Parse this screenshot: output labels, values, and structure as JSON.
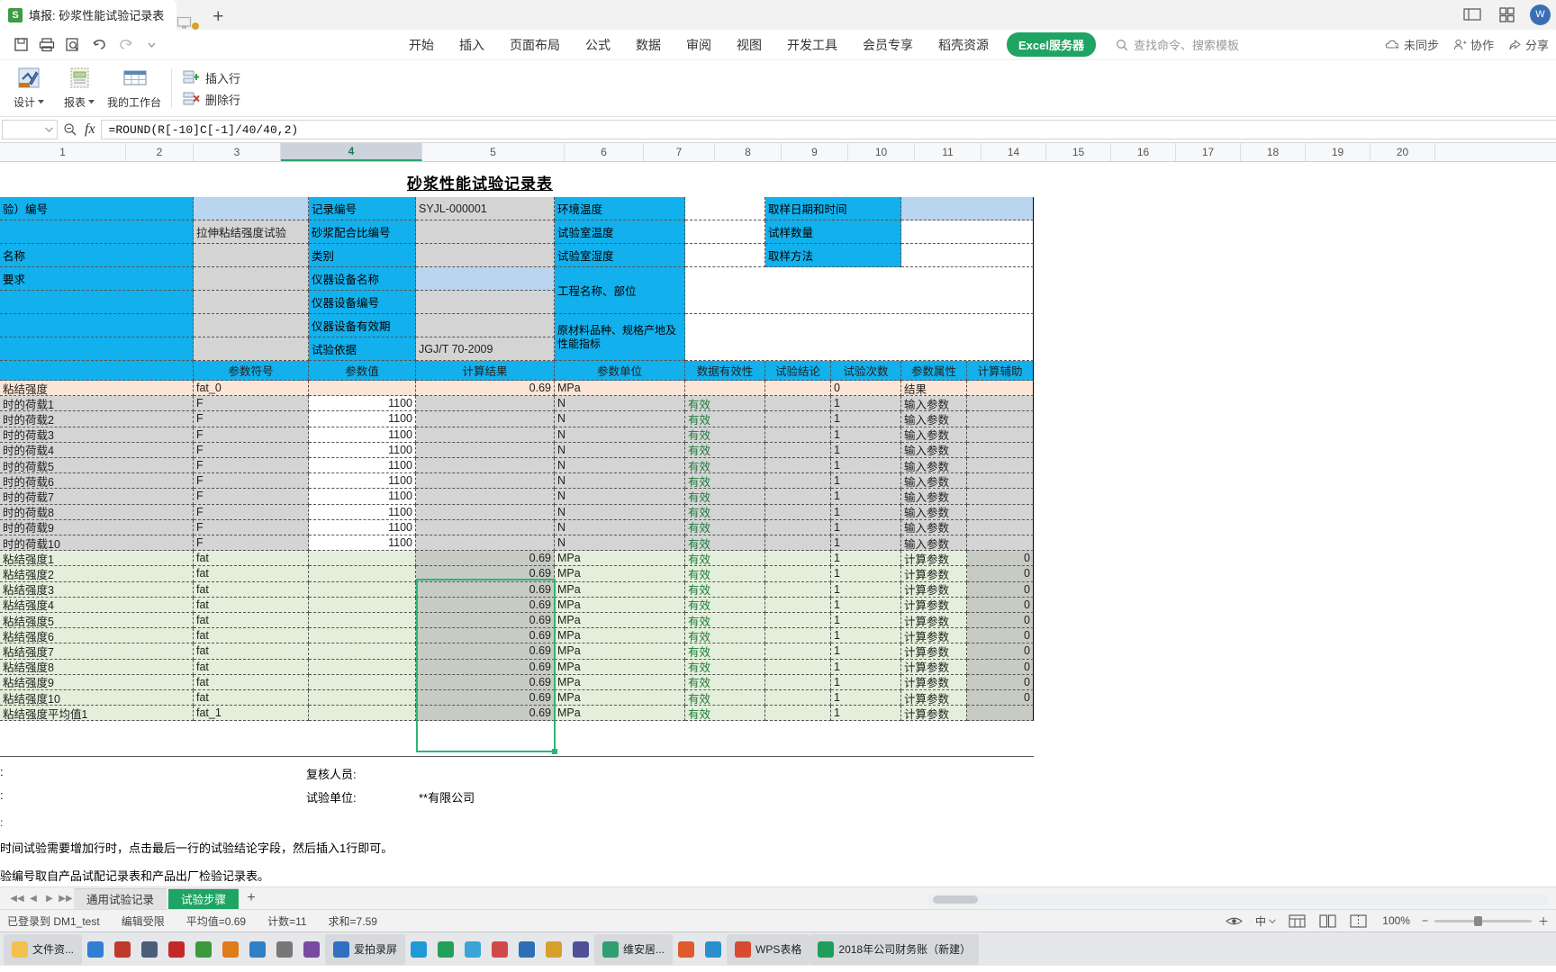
{
  "titlebar": {
    "doc_title": "填报: 砂浆性能试验记录表",
    "logo_text": "S",
    "new_tab_label": "+",
    "icons": [
      "monitor-icon",
      "unsaved-dot",
      "restore-icon",
      "grid-icon",
      "avatar"
    ],
    "avatar_initial": "W"
  },
  "quick_access": {
    "items": [
      "save-icon",
      "print-icon",
      "print-preview-icon",
      "undo-icon",
      "redo-icon",
      "customize-chevron-icon"
    ]
  },
  "menus": {
    "items": [
      "开始",
      "插入",
      "页面布局",
      "公式",
      "数据",
      "审阅",
      "视图",
      "开发工具",
      "会员专享",
      "稻壳资源"
    ],
    "pill": "Excel服务器",
    "search_placeholder": "查找命令、搜索模板",
    "right_items": [
      "未同步",
      "协作",
      "分享"
    ]
  },
  "ribbon": {
    "buttons": [
      {
        "label": "设计",
        "icon": "design-icon",
        "has_caret": true
      },
      {
        "label": "报表",
        "icon": "report-icon",
        "has_caret": true
      },
      {
        "label": "我的工作台",
        "icon": "workbench-icon",
        "has_caret": false
      }
    ],
    "row_actions": [
      {
        "label": "插入行",
        "icon": "insert-row-icon"
      },
      {
        "label": "删除行",
        "icon": "delete-row-icon"
      }
    ]
  },
  "formula_bar": {
    "name_box": "",
    "formula": "=ROUND(R[-10]C[-1]/40/40,2)",
    "fx_label": "fx"
  },
  "columns": {
    "labels": [
      "1",
      "2",
      "3",
      "4",
      "5",
      "6",
      "7",
      "8",
      "9",
      "10",
      "11",
      "14",
      "15",
      "16",
      "17",
      "18",
      "19",
      "20"
    ],
    "selected": "4"
  },
  "sheet": {
    "doc_title": "砂浆性能试验记录表",
    "header_block": [
      {
        "c1": "验）编号",
        "c2": "",
        "c3": "记录编号",
        "c4": "SYJL-000001",
        "c5": "环境温度",
        "c6": "",
        "c7": "取样日期和时间",
        "c8": ""
      },
      {
        "c1": "",
        "c2": "拉伸粘结强度试验",
        "c3": "砂浆配合比编号",
        "c4": "",
        "c5": "试验室温度",
        "c6": "",
        "c7": "试样数量",
        "c8": ""
      },
      {
        "c1": "名称",
        "c2": "",
        "c3": "类别",
        "c4": "",
        "c5": "试验室湿度",
        "c6": "",
        "c7": "取样方法",
        "c8": ""
      },
      {
        "c1": "要求",
        "c2": "",
        "c3": "仪器设备名称",
        "c4": "",
        "c5": "工程名称、部位",
        "c6": "",
        "c7": "",
        "c8": ""
      },
      {
        "c1": "",
        "c2": "",
        "c3": "仪器设备编号",
        "c4": "",
        "c5": "",
        "c6": "",
        "c7": "",
        "c8": ""
      },
      {
        "c1": "",
        "c2": "",
        "c3": "仪器设备有效期",
        "c4": "",
        "c5": "原材料品种、规格产地及性能指标",
        "c6": "",
        "c7": "",
        "c8": ""
      },
      {
        "c1": "",
        "c2": "",
        "c3": "试验依据",
        "c4": "JGJ/T 70-2009",
        "c5": "",
        "c6": "",
        "c7": "",
        "c8": ""
      }
    ],
    "table_headers": [
      "",
      "参数符号",
      "参数值",
      "计算结果",
      "参数单位",
      "数据有效性",
      "试验结论",
      "试验次数",
      "参数属性",
      "计算辅助"
    ],
    "rows": [
      {
        "name": "粘结强度",
        "symbol": "fat_0",
        "value": "",
        "result": "0.69",
        "unit": "MPa",
        "validity": "",
        "conclusion": "",
        "count": "0",
        "attr": "结果",
        "aux": "",
        "style": "result"
      },
      {
        "name": "时的荷载1",
        "symbol": "F",
        "value": "1100",
        "result": "",
        "unit": "N",
        "validity": "有效",
        "conclusion": "",
        "count": "1",
        "attr": "输入参数",
        "aux": "",
        "style": "input"
      },
      {
        "name": "时的荷载2",
        "symbol": "F",
        "value": "1100",
        "result": "",
        "unit": "N",
        "validity": "有效",
        "conclusion": "",
        "count": "1",
        "attr": "输入参数",
        "aux": "",
        "style": "input"
      },
      {
        "name": "时的荷载3",
        "symbol": "F",
        "value": "1100",
        "result": "",
        "unit": "N",
        "validity": "有效",
        "conclusion": "",
        "count": "1",
        "attr": "输入参数",
        "aux": "",
        "style": "input"
      },
      {
        "name": "时的荷载4",
        "symbol": "F",
        "value": "1100",
        "result": "",
        "unit": "N",
        "validity": "有效",
        "conclusion": "",
        "count": "1",
        "attr": "输入参数",
        "aux": "",
        "style": "input"
      },
      {
        "name": "时的荷载5",
        "symbol": "F",
        "value": "1100",
        "result": "",
        "unit": "N",
        "validity": "有效",
        "conclusion": "",
        "count": "1",
        "attr": "输入参数",
        "aux": "",
        "style": "input"
      },
      {
        "name": "时的荷载6",
        "symbol": "F",
        "value": "1100",
        "result": "",
        "unit": "N",
        "validity": "有效",
        "conclusion": "",
        "count": "1",
        "attr": "输入参数",
        "aux": "",
        "style": "input"
      },
      {
        "name": "时的荷载7",
        "symbol": "F",
        "value": "1100",
        "result": "",
        "unit": "N",
        "validity": "有效",
        "conclusion": "",
        "count": "1",
        "attr": "输入参数",
        "aux": "",
        "style": "input"
      },
      {
        "name": "时的荷载8",
        "symbol": "F",
        "value": "1100",
        "result": "",
        "unit": "N",
        "validity": "有效",
        "conclusion": "",
        "count": "1",
        "attr": "输入参数",
        "aux": "",
        "style": "input"
      },
      {
        "name": "时的荷载9",
        "symbol": "F",
        "value": "1100",
        "result": "",
        "unit": "N",
        "validity": "有效",
        "conclusion": "",
        "count": "1",
        "attr": "输入参数",
        "aux": "",
        "style": "input"
      },
      {
        "name": "时的荷载10",
        "symbol": "F",
        "value": "1100",
        "result": "",
        "unit": "N",
        "validity": "有效",
        "conclusion": "",
        "count": "1",
        "attr": "输入参数",
        "aux": "",
        "style": "input"
      },
      {
        "name": "粘结强度1",
        "symbol": "fat",
        "value": "",
        "result": "0.69",
        "unit": "MPa",
        "validity": "有效",
        "conclusion": "",
        "count": "1",
        "attr": "计算参数",
        "aux": "0",
        "style": "calc"
      },
      {
        "name": "粘结强度2",
        "symbol": "fat",
        "value": "",
        "result": "0.69",
        "unit": "MPa",
        "validity": "有效",
        "conclusion": "",
        "count": "1",
        "attr": "计算参数",
        "aux": "0",
        "style": "calc"
      },
      {
        "name": "粘结强度3",
        "symbol": "fat",
        "value": "",
        "result": "0.69",
        "unit": "MPa",
        "validity": "有效",
        "conclusion": "",
        "count": "1",
        "attr": "计算参数",
        "aux": "0",
        "style": "calc"
      },
      {
        "name": "粘结强度4",
        "symbol": "fat",
        "value": "",
        "result": "0.69",
        "unit": "MPa",
        "validity": "有效",
        "conclusion": "",
        "count": "1",
        "attr": "计算参数",
        "aux": "0",
        "style": "calc"
      },
      {
        "name": "粘结强度5",
        "symbol": "fat",
        "value": "",
        "result": "0.69",
        "unit": "MPa",
        "validity": "有效",
        "conclusion": "",
        "count": "1",
        "attr": "计算参数",
        "aux": "0",
        "style": "calc"
      },
      {
        "name": "粘结强度6",
        "symbol": "fat",
        "value": "",
        "result": "0.69",
        "unit": "MPa",
        "validity": "有效",
        "conclusion": "",
        "count": "1",
        "attr": "计算参数",
        "aux": "0",
        "style": "calc"
      },
      {
        "name": "粘结强度7",
        "symbol": "fat",
        "value": "",
        "result": "0.69",
        "unit": "MPa",
        "validity": "有效",
        "conclusion": "",
        "count": "1",
        "attr": "计算参数",
        "aux": "0",
        "style": "calc"
      },
      {
        "name": "粘结强度8",
        "symbol": "fat",
        "value": "",
        "result": "0.69",
        "unit": "MPa",
        "validity": "有效",
        "conclusion": "",
        "count": "1",
        "attr": "计算参数",
        "aux": "0",
        "style": "calc"
      },
      {
        "name": "粘结强度9",
        "symbol": "fat",
        "value": "",
        "result": "0.69",
        "unit": "MPa",
        "validity": "有效",
        "conclusion": "",
        "count": "1",
        "attr": "计算参数",
        "aux": "0",
        "style": "calc"
      },
      {
        "name": "粘结强度10",
        "symbol": "fat",
        "value": "",
        "result": "0.69",
        "unit": "MPa",
        "validity": "有效",
        "conclusion": "",
        "count": "1",
        "attr": "计算参数",
        "aux": "0",
        "style": "calc"
      },
      {
        "name": "粘结强度平均值1",
        "symbol": "fat_1",
        "value": "",
        "result": "0.69",
        "unit": "MPa",
        "validity": "有效",
        "conclusion": "",
        "count": "1",
        "attr": "计算参数",
        "aux": "",
        "style": "calc"
      }
    ],
    "footer": {
      "reviewer_label": "复核人员:",
      "unit_label": "试验单位:",
      "unit_value": "**有限公司",
      "left_mark_1": ":",
      "left_mark_2": ":",
      "note_1": "时间试验需要增加行时，点击最后一行的试验结论字段，然后插入1行即可。",
      "note_2": "验编号取自产品试配记录表和产品出厂检验记录表。"
    }
  },
  "sheet_tabs": {
    "tabs": [
      "通用试验记录",
      "试验步骤"
    ],
    "active": "试验步骤",
    "add_label": "+"
  },
  "status_bar": {
    "login": "已登录到 DM1_test",
    "edit_mode": "编辑受限",
    "average": "平均值=0.69",
    "count": "计数=11",
    "sum": "求和=7.59",
    "zoom": "100%",
    "ime": "中",
    "view_icons": [
      "normal-view-icon",
      "page-layout-icon",
      "page-break-icon"
    ]
  },
  "taskbar": {
    "items": [
      {
        "label": "文件资...",
        "color": "#f2c14e",
        "named": true
      },
      {
        "label": "",
        "color": "#2f7fd4",
        "named": false
      },
      {
        "label": "",
        "color": "#c0392b",
        "named": false
      },
      {
        "label": "",
        "color": "#4a5e7a",
        "named": false
      },
      {
        "label": "",
        "color": "#c62828",
        "named": false
      },
      {
        "label": "",
        "color": "#3c9a3c",
        "named": false
      },
      {
        "label": "",
        "color": "#e07b1b",
        "named": false
      },
      {
        "label": "",
        "color": "#2f80c4",
        "named": false
      },
      {
        "label": "",
        "color": "#777777",
        "named": false
      },
      {
        "label": "",
        "color": "#7a4aa0",
        "named": false
      },
      {
        "label": "爱拍录屏",
        "color": "#2f6fc4",
        "named": true
      },
      {
        "label": "",
        "color": "#1f9ad6",
        "named": false
      },
      {
        "label": "",
        "color": "#25a05a",
        "named": false
      },
      {
        "label": "",
        "color": "#3aa3d8",
        "named": false
      },
      {
        "label": "",
        "color": "#d04a4a",
        "named": false
      },
      {
        "label": "",
        "color": "#2d6fb5",
        "named": false
      },
      {
        "label": "",
        "color": "#d8a02a",
        "named": false
      },
      {
        "label": "",
        "color": "#4f4f9a",
        "named": false
      },
      {
        "label": "维安居...",
        "color": "#2f9f6f",
        "named": true
      },
      {
        "label": "",
        "color": "#e05a2b",
        "named": false
      },
      {
        "label": "",
        "color": "#2a8fcf",
        "named": false
      },
      {
        "label": "WPS表格",
        "color": "#d84a32",
        "named": true
      },
      {
        "label": "2018年公司财务账（新建）",
        "color": "#1f9e5a",
        "named": true
      }
    ]
  }
}
